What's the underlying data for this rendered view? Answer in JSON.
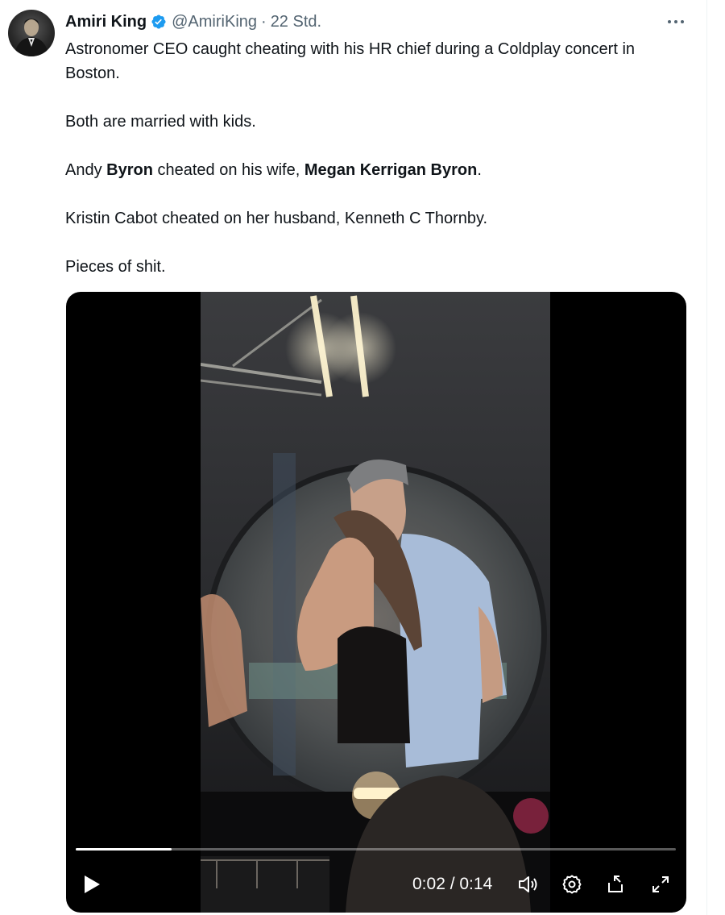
{
  "tweet": {
    "author": {
      "display_name": "Amiri King",
      "handle": "@AmiriKing",
      "separator": "·",
      "time": "22 Std.",
      "verified": true,
      "avatar_icon": "profile-photo"
    },
    "more_icon": "more-horizontal-icon",
    "text": {
      "line1": "Astronomer CEO caught cheating with his HR chief during a Coldplay concert in Boston.",
      "line2": "Both are married with kids.",
      "line3_a": "Andy ",
      "line3_b": "Byron",
      "line3_c": " cheated on his wife, ",
      "line3_d": "Megan Kerrigan Byron",
      "line3_e": ".",
      "line4": "Kristin Cabot cheated on her husband, Kenneth C Thornby.",
      "line5": "Pieces of shit."
    },
    "video": {
      "current_time": "0:02",
      "duration": "0:14",
      "timecode": "0:02 / 0:14",
      "progress": 0.16,
      "icons": [
        "play-icon",
        "volume-icon",
        "settings-icon",
        "dock-icon",
        "fullscreen-icon"
      ]
    }
  },
  "colors": {
    "text": "#0f1419",
    "secondary": "#536471",
    "verified": "#1d9bf0",
    "video_bg": "#000000"
  }
}
